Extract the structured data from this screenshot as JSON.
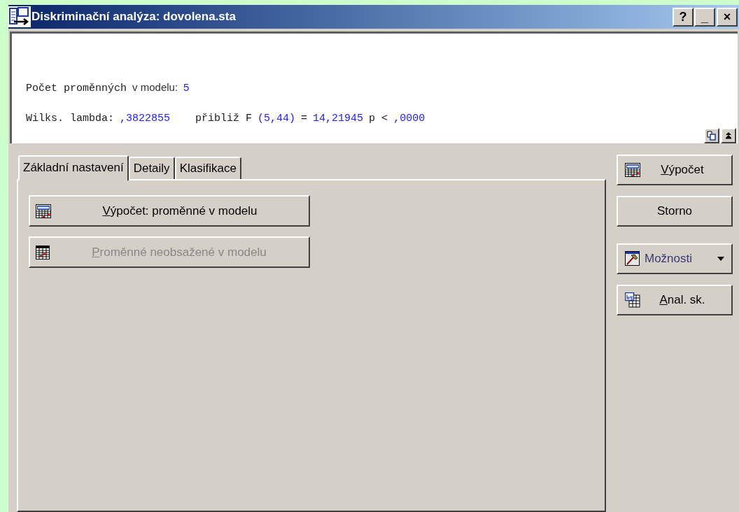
{
  "window": {
    "title": "Diskriminační analýza: dovolena.sta",
    "controls": [
      {
        "kind": "help",
        "label": "?"
      },
      {
        "kind": "minimize",
        "label": "_"
      },
      {
        "kind": "close",
        "label": "×"
      }
    ]
  },
  "output": {
    "lines": [
      [
        {
          "text": "Počet proměnných",
          "kind": "mono"
        },
        {
          "text": "v modelu:",
          "kind": "sans"
        },
        {
          "text": "5",
          "kind": "value_sans"
        }
      ],
      [
        {
          "text": "Wilks. lambda:",
          "kind": "mono"
        },
        {
          "text": ",3822855",
          "kind": "value_mono"
        },
        {
          "text": "přibliž F",
          "kind": "mono"
        },
        {
          "text": "(5,44)",
          "kind": "value_mono"
        },
        {
          "text": "=",
          "kind": "mono"
        },
        {
          "text": "14,21945",
          "kind": "value_mono"
        },
        {
          "text": "p <",
          "kind": "mono"
        },
        {
          "text": ",0000",
          "kind": "value_mono"
        }
      ]
    ]
  },
  "tabs": [
    {
      "label": "Základní nastavení",
      "selected": true
    },
    {
      "label": "Detaily",
      "selected": false
    },
    {
      "label": "Klasifikace",
      "selected": false
    }
  ],
  "panel_buttons": [
    {
      "label": "Výpočet:  proměnné v modelu",
      "kind": "sum",
      "disabled": false
    },
    {
      "label": "Proměnné neobsažené v modelu",
      "kind": "grid",
      "disabled": true
    }
  ],
  "side_buttons": [
    {
      "label": "Výpočet",
      "kind": "sum",
      "underline": true
    },
    {
      "label": "Storno",
      "kind": "plain",
      "underline": false
    },
    {
      "label": "Možnosti",
      "kind": "menu",
      "underline": false,
      "dropdown": true
    },
    {
      "label": "Anal. sk.",
      "kind": "by",
      "underline": true
    }
  ]
}
